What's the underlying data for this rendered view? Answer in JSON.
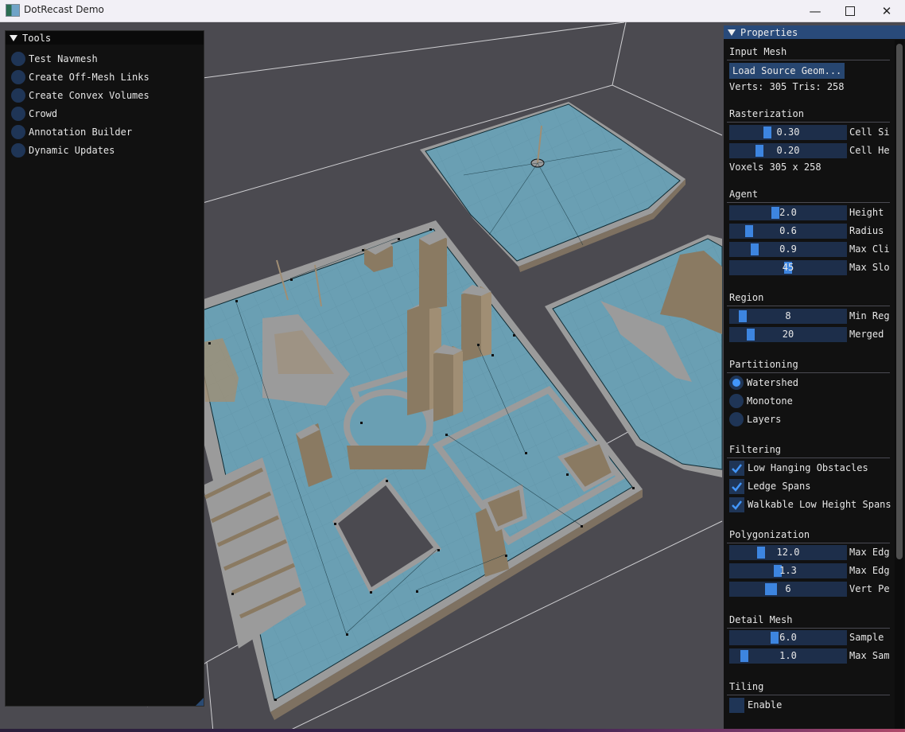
{
  "window": {
    "title": "DotRecast Demo",
    "controls": [
      "minimize",
      "maximize",
      "close"
    ]
  },
  "tools_panel": {
    "title": "Tools",
    "items": [
      {
        "label": "Test Navmesh",
        "selected": false
      },
      {
        "label": "Create Off-Mesh Links",
        "selected": false
      },
      {
        "label": "Create Convex Volumes",
        "selected": false
      },
      {
        "label": "Crowd",
        "selected": false
      },
      {
        "label": "Annotation Builder",
        "selected": false
      },
      {
        "label": "Dynamic Updates",
        "selected": false
      }
    ]
  },
  "properties_panel": {
    "title": "Properties",
    "input_mesh": {
      "title": "Input Mesh",
      "load_button": "Load Source Geom...",
      "stats": "Verts: 305 Tris: 258"
    },
    "rasterization": {
      "title": "Rasterization",
      "sliders": [
        {
          "value": "0.30",
          "label": "Cell Size",
          "fraction": 0.3
        },
        {
          "value": "0.20",
          "label": "Cell Height",
          "fraction": 0.22
        }
      ],
      "voxels": "Voxels 305 x 258"
    },
    "agent": {
      "title": "Agent",
      "sliders": [
        {
          "value": "2.0",
          "label": "Height",
          "fraction": 0.38
        },
        {
          "value": "0.6",
          "label": "Radius",
          "fraction": 0.12
        },
        {
          "value": "0.9",
          "label": "Max Climb",
          "fraction": 0.18
        },
        {
          "value": "45",
          "label": "Max Slope",
          "fraction": 0.5
        }
      ]
    },
    "region": {
      "title": "Region",
      "sliders": [
        {
          "value": "8",
          "label": "Min Region Size",
          "fraction": 0.06
        },
        {
          "value": "20",
          "label": "Merged Region Size",
          "fraction": 0.14
        }
      ]
    },
    "partitioning": {
      "title": "Partitioning",
      "options": [
        {
          "label": "Watershed",
          "selected": true
        },
        {
          "label": "Monotone",
          "selected": false
        },
        {
          "label": "Layers",
          "selected": false
        }
      ]
    },
    "filtering": {
      "title": "Filtering",
      "options": [
        {
          "label": "Low Hanging Obstacles",
          "checked": true
        },
        {
          "label": "Ledge Spans",
          "checked": true
        },
        {
          "label": "Walkable Low Height Spans",
          "checked": true
        }
      ]
    },
    "polygonization": {
      "title": "Polygonization",
      "sliders": [
        {
          "value": "12.0",
          "label": "Max Edge Length",
          "fraction": 0.24
        },
        {
          "value": "1.3",
          "label": "Max Edge Error",
          "fraction": 0.4
        },
        {
          "value": "6",
          "label": "Vert Per Poly",
          "fraction": 0.33
        }
      ]
    },
    "detail_mesh": {
      "title": "Detail Mesh",
      "sliders": [
        {
          "value": "6.0",
          "label": "Sample Distance",
          "fraction": 0.37
        },
        {
          "value": "1.0",
          "label": "Max Sample Error",
          "fraction": 0.08
        }
      ]
    },
    "tiling": {
      "title": "Tiling",
      "options": [
        {
          "label": "Enable",
          "checked": false
        }
      ]
    }
  }
}
